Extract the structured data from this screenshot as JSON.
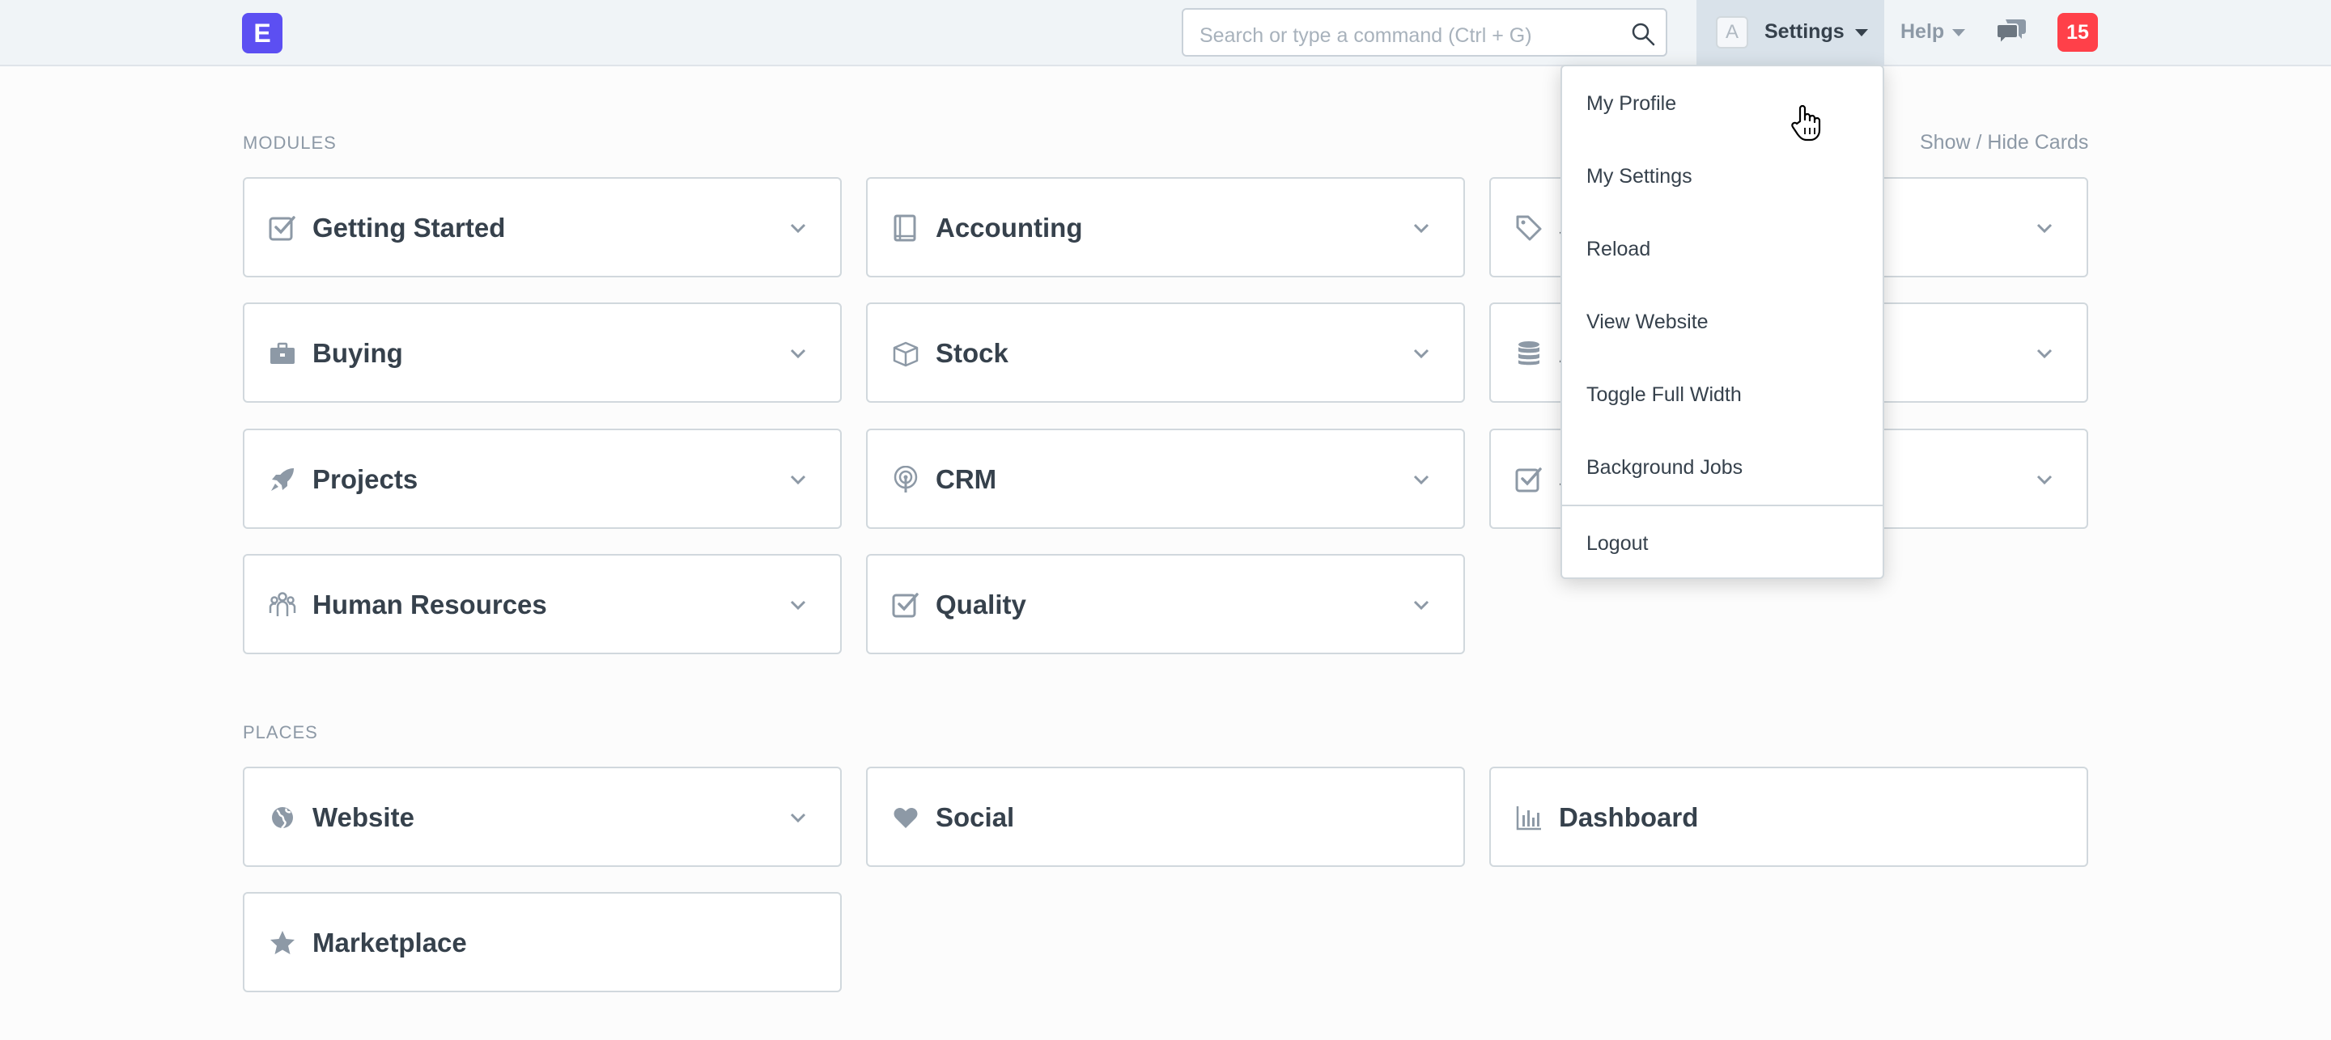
{
  "navbar": {
    "logo_letter": "E",
    "search_placeholder": "Search or type a command (Ctrl + G)",
    "avatar_letter": "A",
    "settings_label": "Settings",
    "help_label": "Help",
    "notification_count": "15"
  },
  "dropdown": {
    "items": [
      "My Profile",
      "My Settings",
      "Reload",
      "View Website",
      "Toggle Full Width",
      "Background Jobs",
      "Logout"
    ]
  },
  "modules": {
    "section_label": "MODULES",
    "show_hide_label": "Show / Hide Cards",
    "cards": [
      {
        "label": "Getting Started",
        "icon": "checkbox-icon"
      },
      {
        "label": "Accounting",
        "icon": "book-icon"
      },
      {
        "label": "S",
        "icon": "tag-icon"
      },
      {
        "label": "Buying",
        "icon": "briefcase-icon"
      },
      {
        "label": "Stock",
        "icon": "box-icon"
      },
      {
        "label": "A",
        "icon": "database-icon"
      },
      {
        "label": "Projects",
        "icon": "rocket-icon"
      },
      {
        "label": "CRM",
        "icon": "broadcast-icon"
      },
      {
        "label": "S",
        "icon": "checkbox-icon"
      },
      {
        "label": "Human Resources",
        "icon": "users-icon"
      },
      {
        "label": "Quality",
        "icon": "checkbox-icon"
      }
    ]
  },
  "places": {
    "section_label": "PLACES",
    "cards": [
      {
        "label": "Website",
        "icon": "globe-icon"
      },
      {
        "label": "Social",
        "icon": "heart-icon"
      },
      {
        "label": "Dashboard",
        "icon": "bar-chart-icon"
      },
      {
        "label": "Marketplace",
        "icon": "star-icon"
      }
    ]
  },
  "colors": {
    "brand": "#5c4ff2",
    "badge": "#ff4049",
    "navbar_bg": "#f0f4f7",
    "icon": "#8d99a6"
  }
}
